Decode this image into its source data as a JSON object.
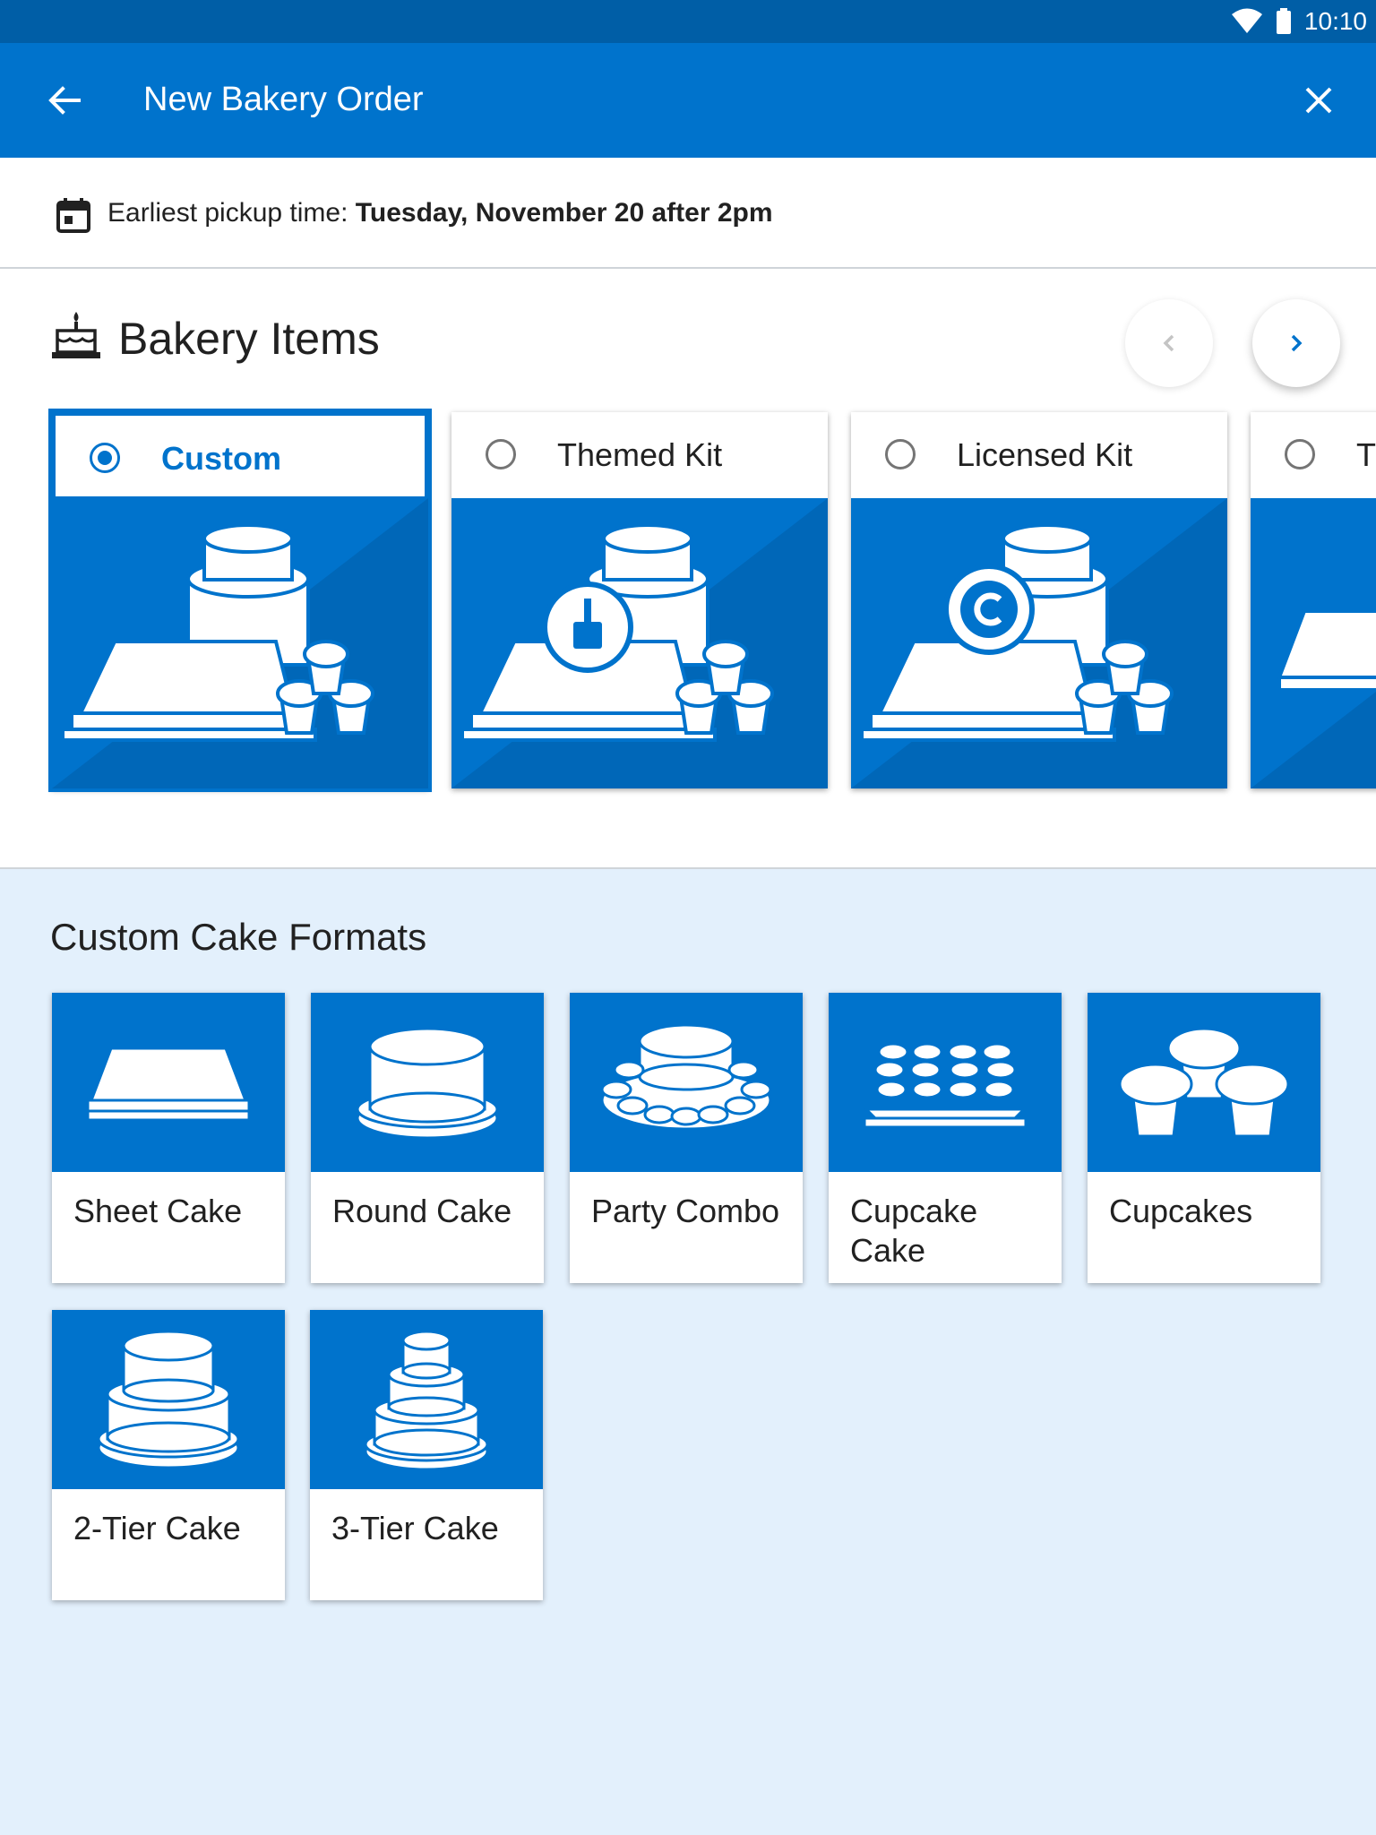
{
  "status_bar": {
    "time": "10:10",
    "icons": [
      "wifi-icon",
      "battery-icon"
    ]
  },
  "app_bar": {
    "title": "New Bakery Order",
    "back_icon": "arrow-left-icon",
    "close_icon": "close-icon"
  },
  "pickup": {
    "label": "Earliest pickup time: ",
    "value": "Tuesday, November 20 after 2pm",
    "icon": "calendar-icon"
  },
  "bakery_items": {
    "title": "Bakery Items",
    "icon": "cake-icon",
    "items": [
      {
        "label": "Custom",
        "selected": true
      },
      {
        "label": "Themed Kit",
        "selected": false,
        "badge": "brush-icon"
      },
      {
        "label": "Licensed Kit",
        "selected": false,
        "badge": "copyright-icon"
      },
      {
        "label": "T",
        "selected": false
      }
    ]
  },
  "formats": {
    "title": "Custom Cake Formats",
    "items": [
      {
        "label": "Sheet Cake",
        "icon": "sheet-cake-icon"
      },
      {
        "label": "Round Cake",
        "icon": "round-cake-icon"
      },
      {
        "label": "Party Combo",
        "icon": "party-combo-icon"
      },
      {
        "label": "Cupcake Cake",
        "icon": "cupcake-cake-icon"
      },
      {
        "label": "Cupcakes",
        "icon": "cupcakes-icon"
      },
      {
        "label": "2-Tier Cake",
        "icon": "two-tier-cake-icon"
      },
      {
        "label": "3-Tier Cake",
        "icon": "three-tier-cake-icon"
      }
    ]
  },
  "colors": {
    "primary": "#0073cc",
    "status_bar": "#005ea6",
    "background": "#e3f0fc"
  }
}
